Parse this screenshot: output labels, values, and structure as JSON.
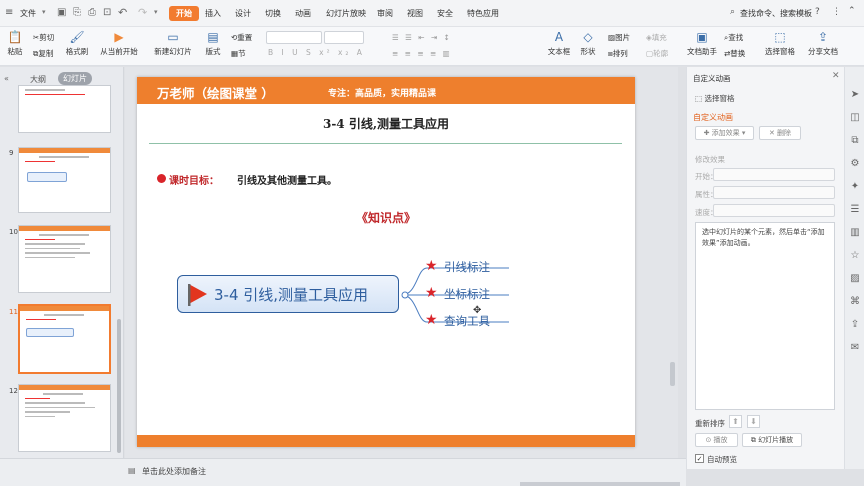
{
  "menubar": {
    "file_label": "文件",
    "tabs": [
      "开始",
      "插入",
      "设计",
      "切换",
      "动画",
      "幻灯片放映",
      "审阅",
      "视图",
      "安全",
      "特色应用"
    ],
    "search_label": "查找命令、搜索模板"
  },
  "ribbon": {
    "paste": "粘贴",
    "cut": "剪切",
    "copy": "复制",
    "format_painter": "格式刷",
    "from_current": "从当前开始",
    "new_slide": "新建幻灯片",
    "layout": "版式",
    "reset": "重置",
    "section": "节",
    "textbox": "文本框",
    "shape": "形状",
    "picture": "图片",
    "arrange": "排列",
    "fill": "填充",
    "outline": "轮廓",
    "doc_helper": "文档助手",
    "find": "查找",
    "replace": "替换",
    "select_pane": "选择窗格",
    "share_doc": "分享文档"
  },
  "left_panel": {
    "tab_outline": "大纲",
    "tab_slides": "幻灯片",
    "slide_numbers": [
      "9",
      "10",
      "11",
      "12"
    ],
    "add_icon": "plus-icon"
  },
  "slide": {
    "header_title": "万老师（绘图课堂 ）",
    "header_tagline": "专注：高品质，实用精品课",
    "title": "3-4 引线,测量工具应用",
    "goal_label": "课时目标：",
    "goal_text": "引线及其他测量工具。",
    "section_title": "《知识点》",
    "main_node": "3-4 引线,测量工具应用",
    "branches": [
      "引线标注",
      "坐标标注",
      "查询工具"
    ]
  },
  "status": {
    "notes_placeholder": "单击此处添加备注"
  },
  "right_panel": {
    "title": "自定义动画",
    "select_pane": "选择窗格",
    "section_title": "自定义动画",
    "add_effect": "添加效果",
    "delete": "删除",
    "modify_effect": "修改效果",
    "start_label": "开始：",
    "property_label": "属性：",
    "speed_label": "速度：",
    "hint": "选中幻灯片的某个元素，然后单击“添加效果”添加动画。",
    "reorder": "重新排序",
    "play": "播放",
    "slideshow": "幻灯片播放",
    "autopreview": "自动预览"
  },
  "colors": {
    "accent": "#f27b2f",
    "slide_header": "#ee7f2d",
    "title_red": "#c0282b",
    "star_red": "#d9242a",
    "node_blue": "#2e5e9e",
    "node_fill": "#dce8f7"
  }
}
